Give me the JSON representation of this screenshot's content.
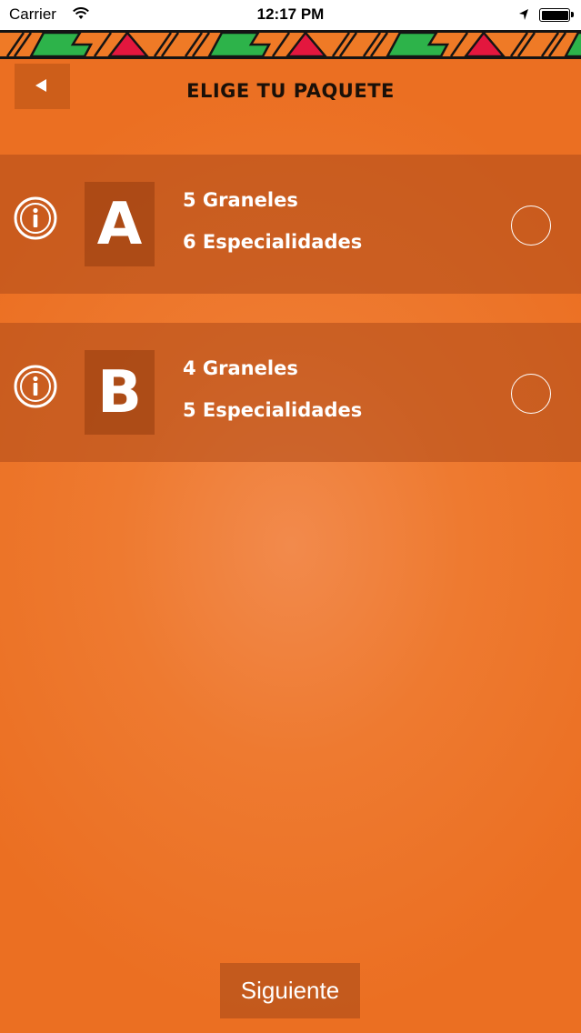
{
  "status_bar": {
    "carrier": "Carrier",
    "time": "12:17 PM"
  },
  "header": {
    "title": "ELIGE TU PAQUETE"
  },
  "packages": [
    {
      "letter": "A",
      "line1": "5 Graneles",
      "line2": "6 Especialidades",
      "selected": false
    },
    {
      "letter": "B",
      "line1": "4 Graneles",
      "line2": "5 Especialidades",
      "selected": false
    }
  ],
  "footer": {
    "next_label": "Siguiente"
  },
  "colors": {
    "background": "#ee7a30",
    "pattern_orange": "#ef7a26",
    "pattern_green": "#2db34a",
    "pattern_red": "#e3173e",
    "pattern_outline": "#141414"
  },
  "icons": [
    "wifi-icon",
    "location-arrow-icon",
    "battery-icon",
    "back-arrow-icon",
    "info-icon",
    "radio-button"
  ]
}
